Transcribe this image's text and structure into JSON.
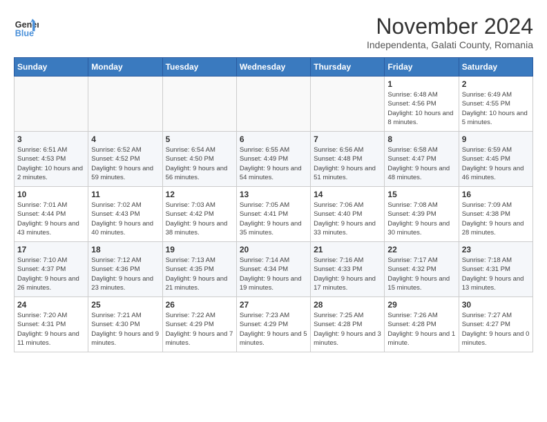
{
  "header": {
    "logo_line1": "General",
    "logo_line2": "Blue",
    "month_title": "November 2024",
    "subtitle": "Independenta, Galati County, Romania"
  },
  "days_of_week": [
    "Sunday",
    "Monday",
    "Tuesday",
    "Wednesday",
    "Thursday",
    "Friday",
    "Saturday"
  ],
  "weeks": [
    [
      {
        "day": "",
        "info": ""
      },
      {
        "day": "",
        "info": ""
      },
      {
        "day": "",
        "info": ""
      },
      {
        "day": "",
        "info": ""
      },
      {
        "day": "",
        "info": ""
      },
      {
        "day": "1",
        "info": "Sunrise: 6:48 AM\nSunset: 4:56 PM\nDaylight: 10 hours and 8 minutes."
      },
      {
        "day": "2",
        "info": "Sunrise: 6:49 AM\nSunset: 4:55 PM\nDaylight: 10 hours and 5 minutes."
      }
    ],
    [
      {
        "day": "3",
        "info": "Sunrise: 6:51 AM\nSunset: 4:53 PM\nDaylight: 10 hours and 2 minutes."
      },
      {
        "day": "4",
        "info": "Sunrise: 6:52 AM\nSunset: 4:52 PM\nDaylight: 9 hours and 59 minutes."
      },
      {
        "day": "5",
        "info": "Sunrise: 6:54 AM\nSunset: 4:50 PM\nDaylight: 9 hours and 56 minutes."
      },
      {
        "day": "6",
        "info": "Sunrise: 6:55 AM\nSunset: 4:49 PM\nDaylight: 9 hours and 54 minutes."
      },
      {
        "day": "7",
        "info": "Sunrise: 6:56 AM\nSunset: 4:48 PM\nDaylight: 9 hours and 51 minutes."
      },
      {
        "day": "8",
        "info": "Sunrise: 6:58 AM\nSunset: 4:47 PM\nDaylight: 9 hours and 48 minutes."
      },
      {
        "day": "9",
        "info": "Sunrise: 6:59 AM\nSunset: 4:45 PM\nDaylight: 9 hours and 46 minutes."
      }
    ],
    [
      {
        "day": "10",
        "info": "Sunrise: 7:01 AM\nSunset: 4:44 PM\nDaylight: 9 hours and 43 minutes."
      },
      {
        "day": "11",
        "info": "Sunrise: 7:02 AM\nSunset: 4:43 PM\nDaylight: 9 hours and 40 minutes."
      },
      {
        "day": "12",
        "info": "Sunrise: 7:03 AM\nSunset: 4:42 PM\nDaylight: 9 hours and 38 minutes."
      },
      {
        "day": "13",
        "info": "Sunrise: 7:05 AM\nSunset: 4:41 PM\nDaylight: 9 hours and 35 minutes."
      },
      {
        "day": "14",
        "info": "Sunrise: 7:06 AM\nSunset: 4:40 PM\nDaylight: 9 hours and 33 minutes."
      },
      {
        "day": "15",
        "info": "Sunrise: 7:08 AM\nSunset: 4:39 PM\nDaylight: 9 hours and 30 minutes."
      },
      {
        "day": "16",
        "info": "Sunrise: 7:09 AM\nSunset: 4:38 PM\nDaylight: 9 hours and 28 minutes."
      }
    ],
    [
      {
        "day": "17",
        "info": "Sunrise: 7:10 AM\nSunset: 4:37 PM\nDaylight: 9 hours and 26 minutes."
      },
      {
        "day": "18",
        "info": "Sunrise: 7:12 AM\nSunset: 4:36 PM\nDaylight: 9 hours and 23 minutes."
      },
      {
        "day": "19",
        "info": "Sunrise: 7:13 AM\nSunset: 4:35 PM\nDaylight: 9 hours and 21 minutes."
      },
      {
        "day": "20",
        "info": "Sunrise: 7:14 AM\nSunset: 4:34 PM\nDaylight: 9 hours and 19 minutes."
      },
      {
        "day": "21",
        "info": "Sunrise: 7:16 AM\nSunset: 4:33 PM\nDaylight: 9 hours and 17 minutes."
      },
      {
        "day": "22",
        "info": "Sunrise: 7:17 AM\nSunset: 4:32 PM\nDaylight: 9 hours and 15 minutes."
      },
      {
        "day": "23",
        "info": "Sunrise: 7:18 AM\nSunset: 4:31 PM\nDaylight: 9 hours and 13 minutes."
      }
    ],
    [
      {
        "day": "24",
        "info": "Sunrise: 7:20 AM\nSunset: 4:31 PM\nDaylight: 9 hours and 11 minutes."
      },
      {
        "day": "25",
        "info": "Sunrise: 7:21 AM\nSunset: 4:30 PM\nDaylight: 9 hours and 9 minutes."
      },
      {
        "day": "26",
        "info": "Sunrise: 7:22 AM\nSunset: 4:29 PM\nDaylight: 9 hours and 7 minutes."
      },
      {
        "day": "27",
        "info": "Sunrise: 7:23 AM\nSunset: 4:29 PM\nDaylight: 9 hours and 5 minutes."
      },
      {
        "day": "28",
        "info": "Sunrise: 7:25 AM\nSunset: 4:28 PM\nDaylight: 9 hours and 3 minutes."
      },
      {
        "day": "29",
        "info": "Sunrise: 7:26 AM\nSunset: 4:28 PM\nDaylight: 9 hours and 1 minute."
      },
      {
        "day": "30",
        "info": "Sunrise: 7:27 AM\nSunset: 4:27 PM\nDaylight: 9 hours and 0 minutes."
      }
    ]
  ]
}
